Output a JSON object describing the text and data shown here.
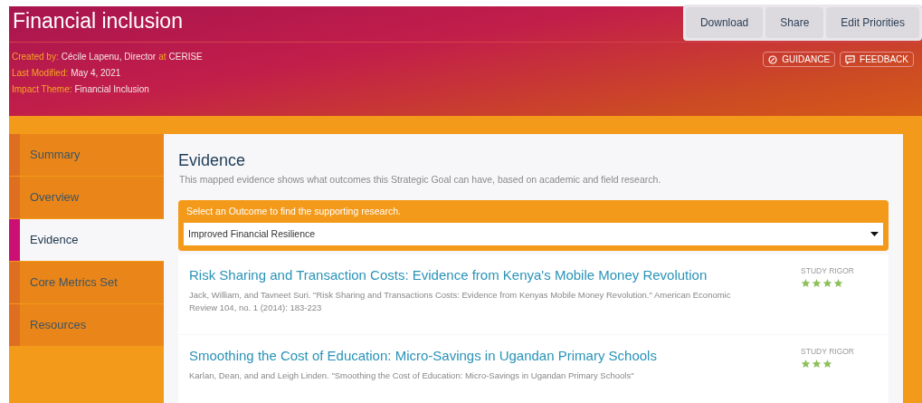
{
  "header": {
    "title": "Financial inclusion",
    "meta": [
      {
        "label": "Created by:",
        "parts": [
          {
            "text": "Cécile Lapenu, Director",
            "kind": "value"
          },
          {
            "text": "at",
            "kind": "label"
          },
          {
            "text": "CERISE",
            "kind": "value"
          }
        ]
      },
      {
        "label": "Last Modified:",
        "parts": [
          {
            "text": "May 4, 2021",
            "kind": "value"
          }
        ]
      },
      {
        "label": "Impact Theme:",
        "parts": [
          {
            "text": "Financial Inclusion",
            "kind": "value"
          }
        ]
      }
    ],
    "buttons": [
      "Download",
      "Share",
      "Edit Priorities"
    ],
    "links": [
      {
        "label": "GUIDANCE",
        "kind": "guidance"
      },
      {
        "label": "FEEDBACK",
        "kind": "feedback"
      }
    ]
  },
  "sidebar": {
    "items": [
      {
        "label": "Summary",
        "selected": false
      },
      {
        "label": "Overview",
        "selected": false
      },
      {
        "label": "Evidence",
        "selected": true
      },
      {
        "label": "Core Metrics Set",
        "selected": false
      },
      {
        "label": "Resources",
        "selected": false
      }
    ]
  },
  "evidence": {
    "title": "Evidence",
    "subtitle": "This mapped evidence shows what outcomes this Strategic Goal can have, based on academic and field research.",
    "select_label": "Select an Outcome to find the supporting research.",
    "select_value": "Improved Financial Resilience",
    "studies": [
      {
        "title": "Risk Sharing and Transaction Costs: Evidence from Kenya's Mobile Money Revolution",
        "citation": "Jack, William, and Tavneet Suri. \"Risk Sharing and Transactions Costs: Evidence from Kenyas Mobile Money Revolution.\" American Economic Review 104, no. 1 (2014): 183-223",
        "rigor_label": "STUDY RIGOR",
        "stars": 4
      },
      {
        "title": "Smoothing the Cost of Education: Micro-Savings in Ugandan Primary Schools",
        "citation": "Karlan, Dean, and and Leigh Linden. \"Smoothing the Cost of Education: Micro-Savings in Ugandan Primary Schools\"",
        "rigor_label": "STUDY RIGOR",
        "stars": 3
      }
    ]
  }
}
